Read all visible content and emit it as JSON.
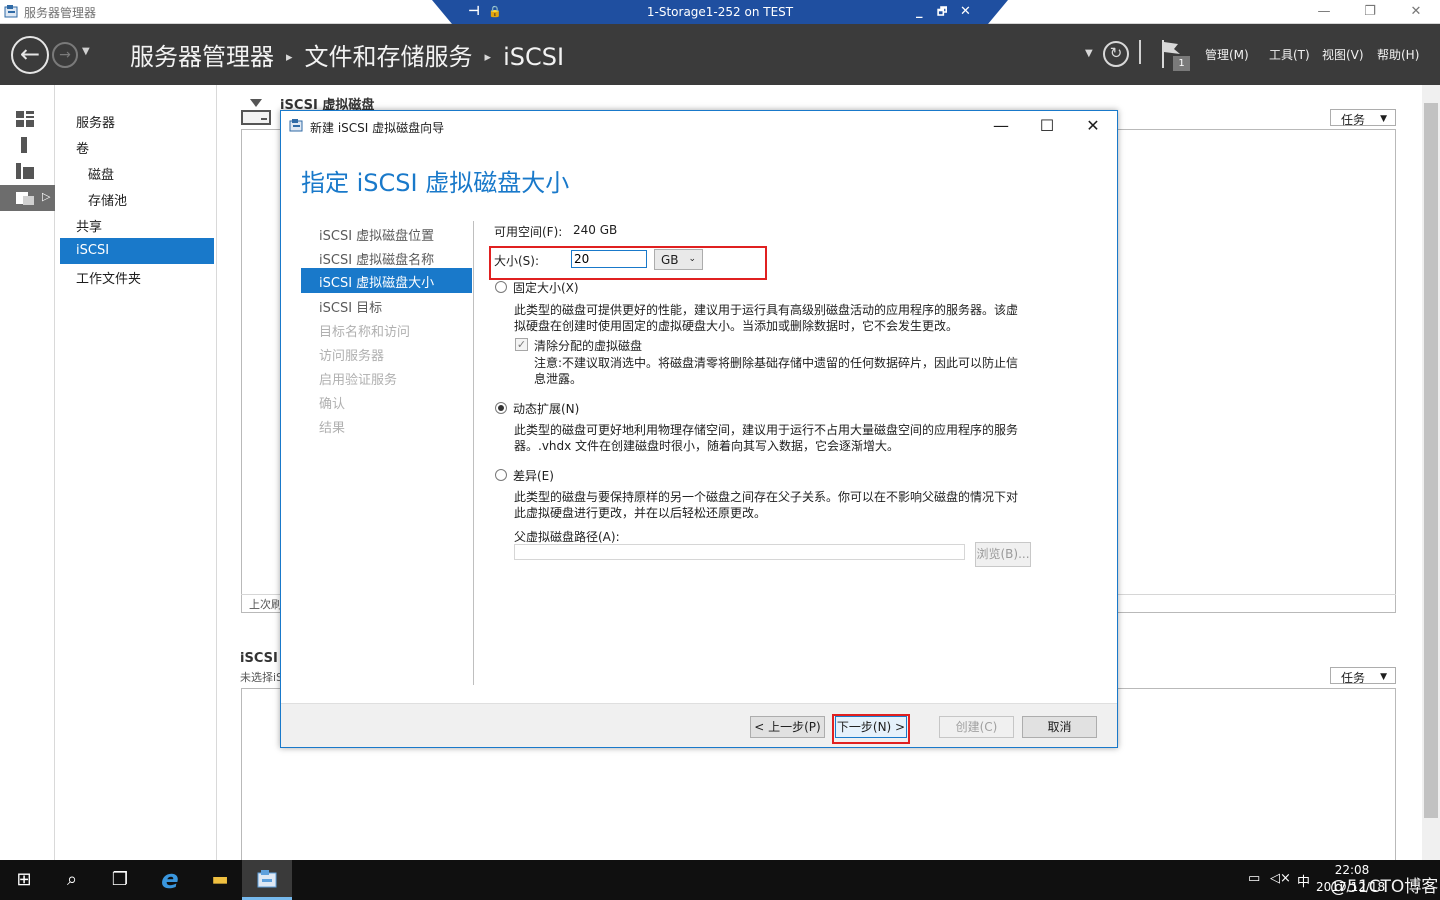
{
  "outer_window": {
    "title": "服务器管理器",
    "minimize": "—",
    "maximize": "❐",
    "close": "✕"
  },
  "rdp_bar": {
    "connection": "1-Storage1-252 on TEST",
    "pin": "⊣",
    "lock": "🔒",
    "minimize": "_",
    "restore": "🗗",
    "close": "✕"
  },
  "header": {
    "back": "←",
    "forward": "→",
    "history_dropdown": "▼",
    "breadcrumb": [
      "服务器管理器",
      "文件和存储服务",
      "iSCSI"
    ],
    "breadcrumb_sep": "▸",
    "refresh": "↻",
    "notification_count": "1",
    "menus": [
      "管理(M)",
      "工具(T)",
      "视图(V)",
      "帮助(H)"
    ],
    "caret": "▼"
  },
  "nav": {
    "items": [
      {
        "label": "服务器",
        "level": 0
      },
      {
        "label": "卷",
        "level": 0
      },
      {
        "label": "磁盘",
        "level": 1
      },
      {
        "label": "存储池",
        "level": 1
      },
      {
        "label": "共享",
        "level": 0
      },
      {
        "label": "iSCSI",
        "level": 0,
        "selected": true
      },
      {
        "label": "工作文件夹",
        "level": 0
      }
    ]
  },
  "content": {
    "section_title": "iSCSI 虚拟磁盘",
    "task_label": "任务",
    "task_caret": "▼",
    "last_refresh_prefix": "上次刷",
    "lower_title": "iSCSI",
    "lower_subtitle": "未选择iS"
  },
  "wizard": {
    "title": "新建 iSCSI 虚拟磁盘向导",
    "minimize": "—",
    "maximize": "☐",
    "close": "✕",
    "heading": "指定 iSCSI 虚拟磁盘大小",
    "steps": [
      {
        "label": "iSCSI 虚拟磁盘位置",
        "state": "done"
      },
      {
        "label": "iSCSI 虚拟磁盘名称",
        "state": "done"
      },
      {
        "label": "iSCSI 虚拟磁盘大小",
        "state": "active"
      },
      {
        "label": "iSCSI 目标",
        "state": "done"
      },
      {
        "label": "目标名称和访问",
        "state": "disabled"
      },
      {
        "label": "访问服务器",
        "state": "disabled"
      },
      {
        "label": "启用验证服务",
        "state": "disabled"
      },
      {
        "label": "确认",
        "state": "disabled"
      },
      {
        "label": "结果",
        "state": "disabled"
      }
    ],
    "available_label": "可用空间(F):",
    "available_value": "240 GB",
    "size_label": "大小(S):",
    "size_value": "20",
    "size_unit": "GB",
    "unit_caret": "⌄",
    "options": {
      "fixed": {
        "label": "固定大小(X)",
        "selected": false,
        "desc1": "此类型的磁盘可提供更好的性能，建议用于运行具有高级别磁盘活动的应用程序的服务器。该虚",
        "desc2": "拟硬盘在创建时使用固定的虚拟硬盘大小。当添加或删除数据时，它不会发生更改。",
        "clear_label": "清除分配的虚拟磁盘",
        "clear_mark": "✓",
        "note1": "注意:不建议取消选中。将磁盘清零将删除基础存储中遗留的任何数据碎片，因此可以防止信",
        "note2": "息泄露。"
      },
      "dynamic": {
        "label": "动态扩展(N)",
        "selected": true,
        "desc1": "此类型的磁盘可更好地利用物理存储空间，建议用于运行不占用大量磁盘空间的应用程序的服务",
        "desc2": "器。.vhdx 文件在创建磁盘时很小，随着向其写入数据，它会逐渐增大。"
      },
      "differencing": {
        "label": "差异(E)",
        "selected": false,
        "desc1": "此类型的磁盘与要保持原样的另一个磁盘之间存在父子关系。你可以在不影响父磁盘的情况下对",
        "desc2": "此虚拟硬盘进行更改，并在以后轻松还原更改。",
        "parent_label": "父虚拟磁盘路径(A):",
        "browse": "浏览(B)..."
      }
    },
    "buttons": {
      "prev": "< 上一步(P)",
      "next": "下一步(N) >",
      "create": "创建(C)",
      "cancel": "取消"
    }
  },
  "taskbar": {
    "start": "⊞",
    "search": "⌕",
    "taskview": "❐",
    "ie": "e",
    "explorer": "▬",
    "time": "22:08",
    "date": "2017/12/18",
    "ime": "中",
    "watermark": "@51CTO博客",
    "network": "▭",
    "volume": "◁×"
  },
  "colors": {
    "accent": "#1979ca",
    "header_bg": "#3b3b3b",
    "highlight": "#e02020"
  }
}
